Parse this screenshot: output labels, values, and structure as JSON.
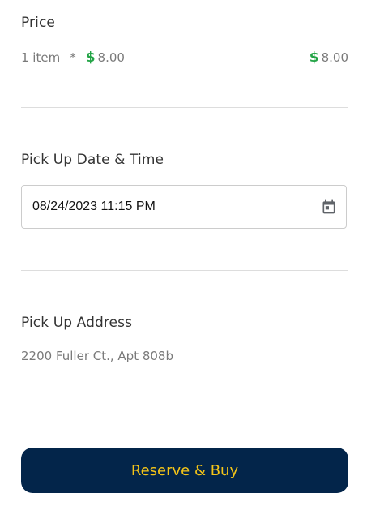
{
  "price": {
    "title": "Price",
    "quantity_label": "1 item",
    "multiplier": "*",
    "currency_symbol": "$",
    "unit_price": "8.00",
    "total_price": "8.00",
    "accent_color": "#23a446"
  },
  "pickup_datetime": {
    "title": "Pick Up Date & Time",
    "value": "08/24/2023 11:15 PM",
    "icon": "calendar-icon"
  },
  "pickup_address": {
    "title": "Pick Up Address",
    "value": "2200 Fuller Ct., Apt 808b"
  },
  "actions": {
    "primary_label": "Reserve & Buy",
    "primary_bg": "#03254a",
    "primary_text_color": "#f5c518"
  }
}
